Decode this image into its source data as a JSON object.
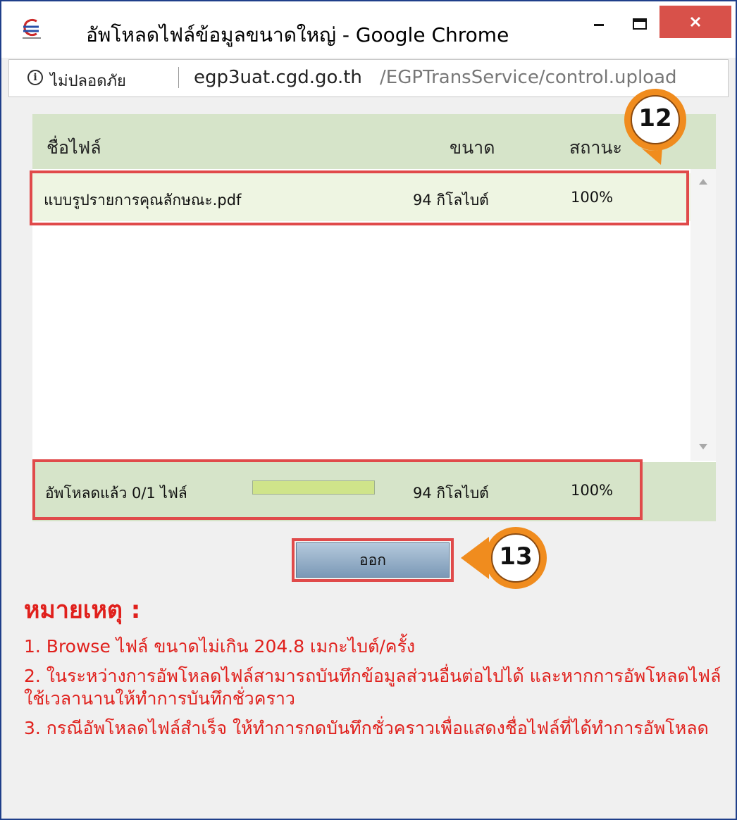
{
  "window": {
    "title": "อัพโหลดไฟล์ข้อมูลขนาดใหญ่ - Google Chrome"
  },
  "address": {
    "security_label": "ไม่ปลอดภัย",
    "url_host": "egp3uat.cgd.go.th",
    "url_path": "/EGPTransService/control.upload"
  },
  "table": {
    "columns": [
      "ชื่อไฟล์",
      "ขนาด",
      "สถานะ"
    ],
    "rows": [
      {
        "name": "แบบรูปรายการคุณลักษณะ.pdf",
        "size": "94 กิโลไบต์",
        "status": "100%"
      }
    ]
  },
  "summary": {
    "label": "อัพโหลดแล้ว 0/1 ไฟล์",
    "progress_fraction": 1.0,
    "size": "94 กิโลไบต์",
    "status": "100%"
  },
  "button": {
    "exit_label": "ออก"
  },
  "markers": [
    "12",
    "13"
  ],
  "notes": {
    "title": "หมายเหตุ :",
    "items": [
      "1. Browse ไฟล์ ขนาดไม่เกิน 204.8 เมกะไบต์/ครั้ง",
      "2. ในระหว่างการอัพโหลดไฟล์สามารถบันทึกข้อมูลส่วนอื่นต่อไปได้ และหากการอัพโหลดไฟล์ใช้เวลานานให้ทำการบันทึกชั่วคราว",
      "3. กรณีอัพโหลดไฟล์สำเร็จ ให้ทำการกดบันทึกชั่วคราวเพื่อแสดงชื่อไฟล์ที่ได้ทำการอัพโหลด"
    ]
  },
  "colors": {
    "highlight": "#e04a4a",
    "marker": "#f08c1e",
    "notes_text": "#e0201c",
    "header_bg": "#d6e4c9",
    "close_button": "#d8514a"
  },
  "icons": {
    "app": "e-gp-logo-icon",
    "info": "info-icon",
    "minimize": "minimize-icon",
    "maximize": "maximize-icon",
    "close": "close-icon"
  }
}
